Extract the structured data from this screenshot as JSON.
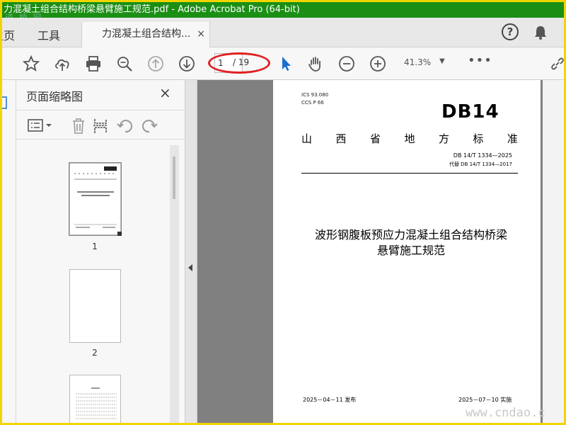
{
  "window": {
    "title": "力混凝土组合结构桥梁悬臂施工规范.pdf - Adobe Acrobat Pro (64-bit)",
    "watermark_top": "道 桥 网"
  },
  "tabs": {
    "home": "主页",
    "tools": "工具",
    "document": "力混凝土组合结构...",
    "close": "×"
  },
  "toolbar": {
    "current_page": "1",
    "total_pages": "/ 19",
    "zoom": "41.3%"
  },
  "thumbnails_panel": {
    "title": "页面缩略图",
    "close": "×",
    "pages": [
      {
        "label": "1"
      },
      {
        "label": "2"
      }
    ]
  },
  "document": {
    "ics": "ICS  93.080",
    "ccs": "CCS  P  66",
    "standard_mark": "DB14",
    "province_chars": [
      "山",
      "西",
      "省",
      "地",
      "方",
      "标",
      "准"
    ],
    "standard_number": "DB 14/T  1334—2025",
    "replaces": "代替 DB 14/T 1334—2017",
    "title_line1": "波形钢腹板预应力混凝土组合结构桥梁",
    "title_line2": "悬臂施工规范",
    "publish_date": "2025－04－11 发布",
    "implement_date": "2025－07－10 实施"
  },
  "watermark_bottom": "www.cndao.c"
}
